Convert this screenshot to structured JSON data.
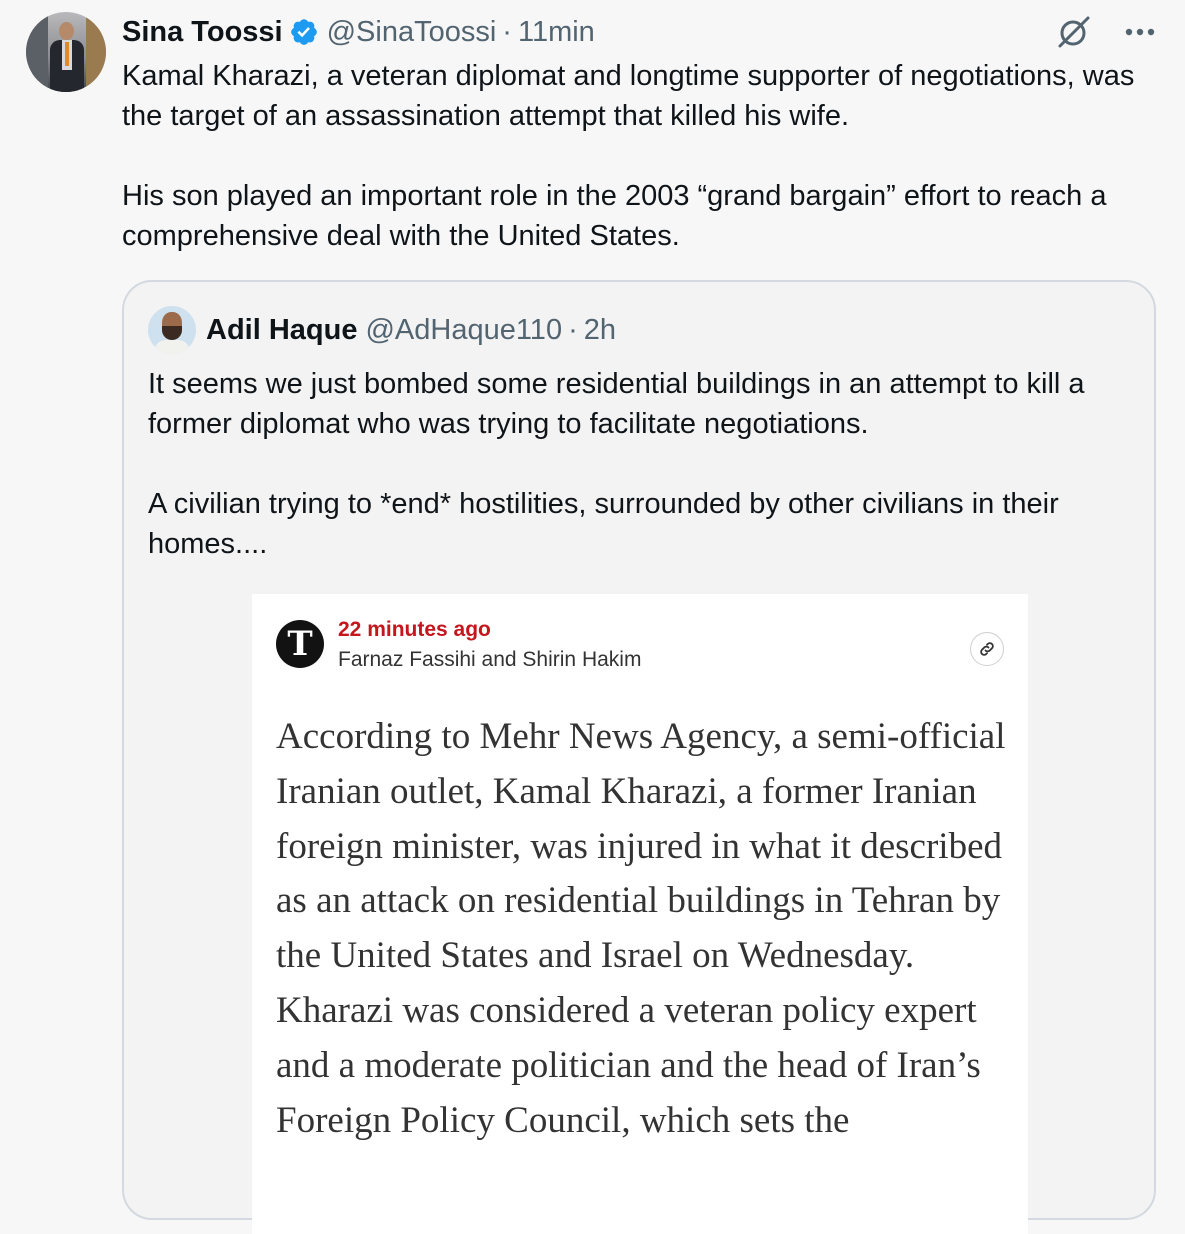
{
  "tweet": {
    "author_name": "Sina Toossi",
    "handle": "@SinaToossi",
    "separator": "·",
    "time": "11min",
    "paragraphs": [
      "Kamal Kharazi, a veteran diplomat and longtime supporter of negotiations, was the target of an assassination attempt that killed his wife.",
      "His son played an important role in the 2003 “grand bargain” effort to reach a comprehensive deal with the United States."
    ]
  },
  "quote": {
    "author_name": "Adil Haque",
    "handle": "@AdHaque110",
    "separator": "·",
    "time": "2h",
    "paragraphs": [
      "It seems we just bombed some residential buildings in an attempt to kill a former diplomat who was trying to facilitate negotiations.",
      "A civilian trying to *end* hostilities, surrounded by other civilians in their homes...."
    ]
  },
  "article": {
    "logo_letter": "T",
    "time": "22 minutes ago",
    "authors": "Farnaz Fassihi and Shirin Hakim",
    "body": "According to Mehr News Agency, a semi-official Iranian outlet, Kamal Kharazi, a former Iranian foreign minister, was injured in what it described as an attack on residential buildings in Tehran by the United States and Israel on Wednesday. Kharazi was considered a veteran policy expert and a moderate politician and the head of Iran’s Foreign Policy Council, which sets the"
  },
  "icons": {
    "verified": "verified-badge-icon",
    "grok": "grok-icon",
    "more": "more-options-icon",
    "link": "link-icon"
  },
  "colors": {
    "verified_blue": "#1d9bf0",
    "secondary_text": "#536471",
    "article_time_red": "#c4161c"
  }
}
